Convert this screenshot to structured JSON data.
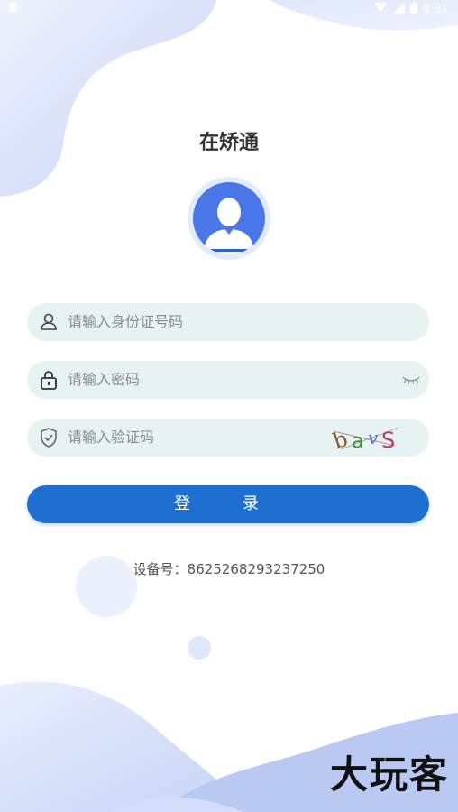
{
  "status_bar": {
    "time": "9:31"
  },
  "app": {
    "title": "在矫通"
  },
  "form": {
    "id_placeholder": "请输入身份证号码",
    "password_placeholder": "请输入密码",
    "captcha_placeholder": "请输入验证码",
    "captcha_text": "bavS"
  },
  "login_button": {
    "label": "登 录"
  },
  "device": {
    "label": "设备号：",
    "number": "8625268293237250"
  },
  "watermark": {
    "text": "大玩客"
  },
  "colors": {
    "primary": "#1f6fd1",
    "avatar": "#4a76e8",
    "field_bg": "#e6f3f2",
    "decor_light": "#dce6fb",
    "decor_mid": "#b8c7f5"
  },
  "icons": {
    "user": "user-outline-icon",
    "lock": "lock-icon",
    "shield": "shield-check-icon",
    "eye": "eye-closed-icon"
  }
}
